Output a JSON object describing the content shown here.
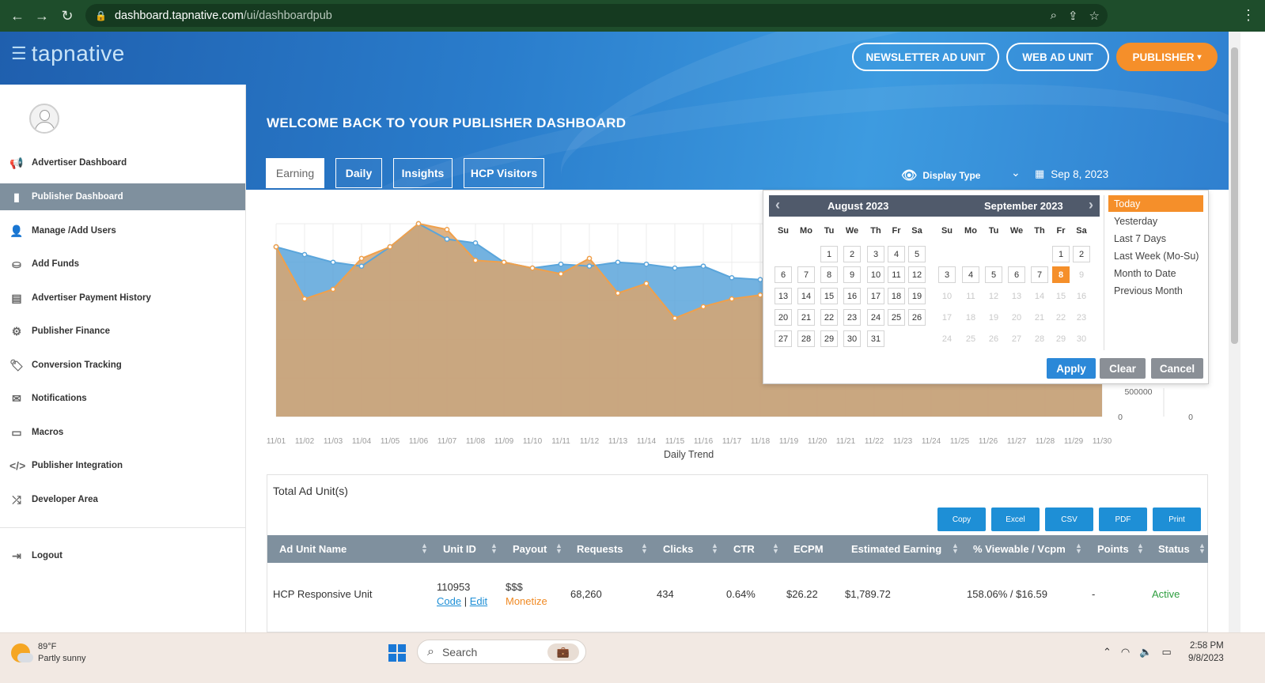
{
  "browser": {
    "url_host": "dashboard.tapnative.com",
    "url_path": "/ui/dashboardpub"
  },
  "header": {
    "logo_text": "tapnative",
    "buttons": [
      "NEWSLETTER AD UNIT",
      "WEB AD UNIT",
      "PUBLISHER"
    ],
    "welcome": "WELCOME BACK TO YOUR PUBLISHER DASHBOARD",
    "tabs": [
      "Earning",
      "Daily",
      "Insights",
      "HCP Visitors"
    ],
    "display_type": "Display Type",
    "date": "Sep 8, 2023"
  },
  "sidebar": {
    "items": [
      {
        "label": "Advertiser Dashboard",
        "icon": "megaphone-icon"
      },
      {
        "label": "Publisher Dashboard",
        "icon": "book-icon"
      },
      {
        "label": "Manage /Add Users",
        "icon": "user-icon"
      },
      {
        "label": "Add Funds",
        "icon": "funds-icon"
      },
      {
        "label": "Advertiser Payment History",
        "icon": "payment-icon"
      },
      {
        "label": "Publisher Finance",
        "icon": "gear-icon"
      },
      {
        "label": "Conversion Tracking",
        "icon": "tag-icon"
      },
      {
        "label": "Notifications",
        "icon": "envelope-icon"
      },
      {
        "label": "Macros",
        "icon": "laptop-icon"
      },
      {
        "label": "Publisher Integration",
        "icon": "code-icon"
      },
      {
        "label": "Developer Area",
        "icon": "shuffle-icon"
      },
      {
        "label": "Logout",
        "icon": "logout-icon"
      }
    ]
  },
  "chart_data": {
    "type": "area",
    "xlabel": "Daily Trend",
    "categories": [
      "11/01",
      "11/02",
      "11/03",
      "11/04",
      "11/05",
      "11/06",
      "11/07",
      "11/08",
      "11/09",
      "11/10",
      "11/11",
      "11/12",
      "11/13",
      "11/14",
      "11/15",
      "11/16",
      "11/17",
      "11/18",
      "11/19",
      "11/20",
      "11/21",
      "11/22",
      "11/23",
      "11/24",
      "11/25",
      "11/26",
      "11/27",
      "11/28",
      "11/29",
      "11/30"
    ],
    "series": [
      {
        "values": [
          0.88,
          0.84,
          0.8,
          0.78,
          0.88,
          1.0,
          0.92,
          0.9,
          0.8,
          0.77,
          0.79,
          0.78,
          0.8,
          0.79,
          0.77,
          0.78,
          0.72,
          0.71,
          0.72,
          0.73,
          0.74,
          0.74,
          0.75,
          0.75,
          0.76,
          0.76,
          0.77,
          0.77,
          0.78,
          0.78
        ],
        "color": "#5aa5db"
      },
      {
        "values": [
          0.88,
          0.61,
          0.66,
          0.82,
          0.88,
          1.0,
          0.97,
          0.81,
          0.8,
          0.77,
          0.74,
          0.82,
          0.64,
          0.69,
          0.51,
          0.57,
          0.61,
          0.63,
          0.64,
          0.65,
          0.66,
          0.66,
          0.67,
          0.67,
          0.68,
          0.68,
          0.69,
          0.69,
          0.7,
          0.7
        ],
        "color": "#f0a04b"
      }
    ],
    "right_axis_1": [
      "500000",
      "0"
    ],
    "right_axis_2": [
      "0"
    ]
  },
  "calendar": {
    "months": [
      "August 2023",
      "September 2023"
    ],
    "weekdays": [
      "Su",
      "Mo",
      "Tu",
      "We",
      "Th",
      "Fr",
      "Sa"
    ],
    "aug_days": [
      [
        "",
        "",
        "1",
        "2",
        "3",
        "4",
        "5"
      ],
      [
        "6",
        "7",
        "8",
        "9",
        "10",
        "11",
        "12"
      ],
      [
        "13",
        "14",
        "15",
        "16",
        "17",
        "18",
        "19"
      ],
      [
        "20",
        "21",
        "22",
        "23",
        "24",
        "25",
        "26"
      ],
      [
        "27",
        "28",
        "29",
        "30",
        "31",
        "",
        ""
      ]
    ],
    "sep_days": [
      [
        "",
        "",
        "",
        "",
        "",
        "1",
        "2"
      ],
      [
        "3",
        "4",
        "5",
        "6",
        "7",
        "8",
        "9"
      ],
      [
        "10",
        "11",
        "12",
        "13",
        "14",
        "15",
        "16"
      ],
      [
        "17",
        "18",
        "19",
        "20",
        "21",
        "22",
        "23"
      ],
      [
        "24",
        "25",
        "26",
        "27",
        "28",
        "29",
        "30"
      ]
    ],
    "selected_day": "8",
    "ranges": [
      "Today",
      "Yesterday",
      "Last 7 Days",
      "Last Week (Mo-Su)",
      "Month to Date",
      "Previous Month"
    ],
    "buttons": {
      "apply": "Apply",
      "clear": "Clear",
      "cancel": "Cancel"
    },
    "colors": {
      "selected": "#f58f2a",
      "apply": "#2b88d8",
      "gray": "#8a8f96"
    }
  },
  "table": {
    "title": "Total Ad Unit(s)",
    "export_buttons": [
      "Copy",
      "Excel",
      "CSV",
      "PDF",
      "Print"
    ],
    "headers": [
      "Ad Unit Name",
      "Unit ID",
      "Payout",
      "Requests",
      "Clicks",
      "CTR",
      "ECPM",
      "Estimated Earning",
      "% Viewable / Vcpm",
      "Points",
      "Status"
    ],
    "row": {
      "name": "HCP Responsive Unit",
      "unit_id": "110953",
      "code": "Code",
      "sep": "|",
      "edit": "Edit",
      "payout": "$$$",
      "payout_sub": "Monetize",
      "requests": "68,260",
      "clicks": "434",
      "ctr": "0.64%",
      "ecpm": "$26.22",
      "earning": "$1,789.72",
      "viewable": "158.06% / $16.59",
      "points": "-",
      "status": "Active"
    }
  },
  "taskbar": {
    "temp": "89°F",
    "weather": "Partly sunny",
    "search": "Search",
    "time": "2:58 PM",
    "date": "9/8/2023"
  }
}
